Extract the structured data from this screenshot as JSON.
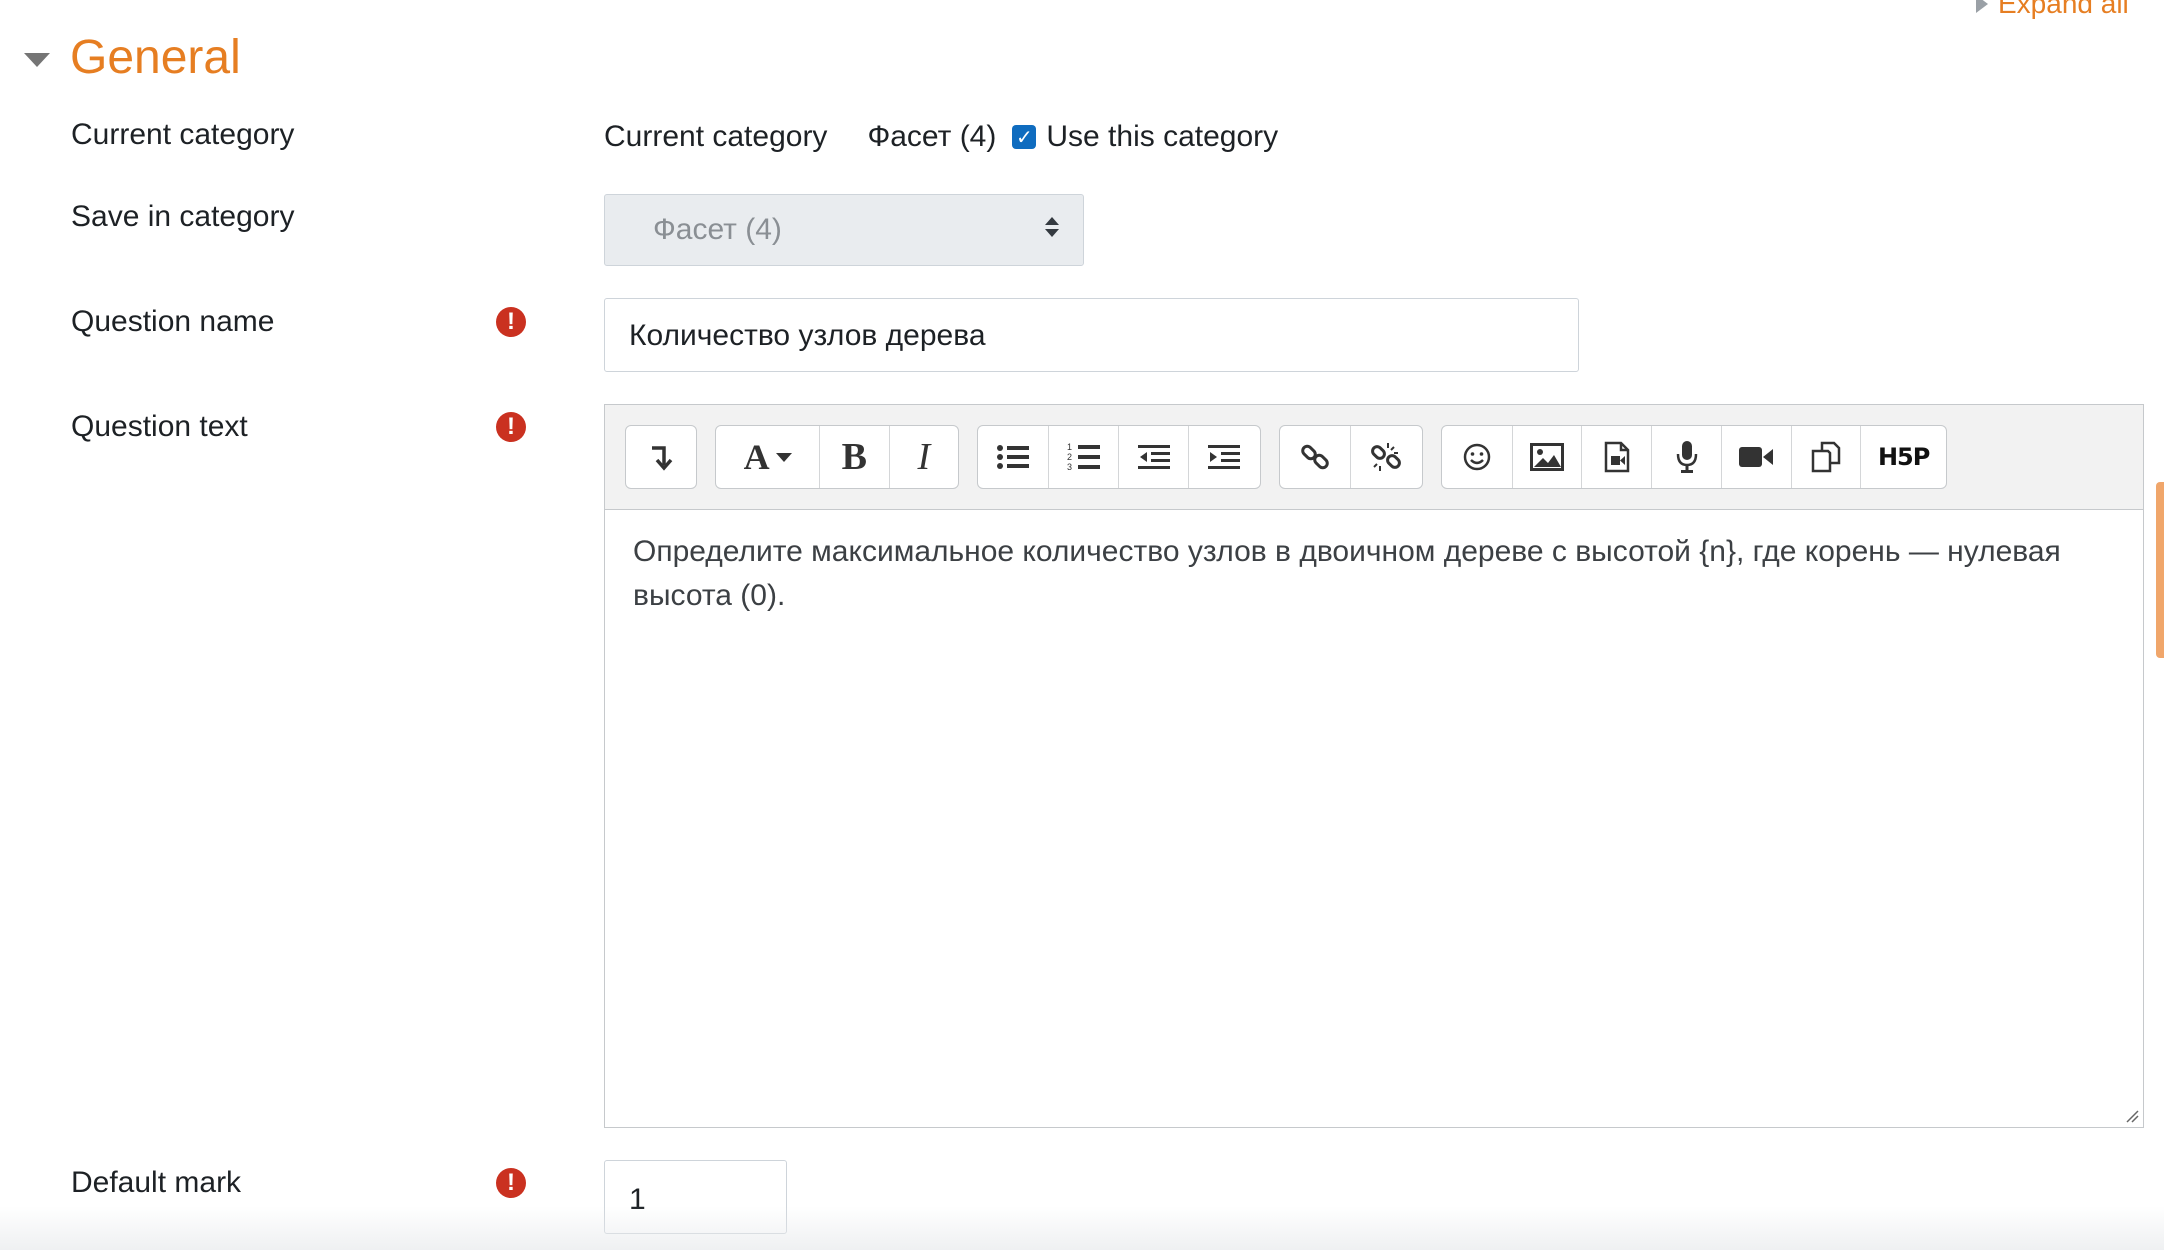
{
  "header": {
    "expand_all": "Expand all",
    "section_title": "General"
  },
  "form": {
    "current_category": {
      "label": "Current category",
      "inline_label": "Current category",
      "value": "Фасет (4)",
      "use_this_category_label": "Use this category",
      "use_this_category_checked": true
    },
    "save_in_category": {
      "label": "Save in category",
      "selected": "Фасет (4)"
    },
    "question_name": {
      "label": "Question name",
      "value": "Количество узлов дерева"
    },
    "question_text": {
      "label": "Question text",
      "content": "Определите максимальное количество узлов в двоичном дереве с высотой {n}, где корень — нулевая высота (0)."
    },
    "default_mark": {
      "label": "Default mark",
      "value": "1"
    }
  },
  "editor_toolbar": {
    "groups": [
      [
        "show-more-buttons-icon"
      ],
      [
        "font-style-icon",
        "bold-icon",
        "italic-icon"
      ],
      [
        "unordered-list-icon",
        "ordered-list-icon",
        "outdent-icon",
        "indent-icon"
      ],
      [
        "link-icon",
        "unlink-icon"
      ],
      [
        "emoji-icon",
        "image-icon",
        "media-icon",
        "record-audio-icon",
        "record-video-icon",
        "manage-files-icon",
        "h5p-icon"
      ]
    ],
    "h5p_label": "H5P"
  },
  "colors": {
    "accent": "#e67e22",
    "required": "#ca3120",
    "checkbox": "#0f6cbf"
  }
}
